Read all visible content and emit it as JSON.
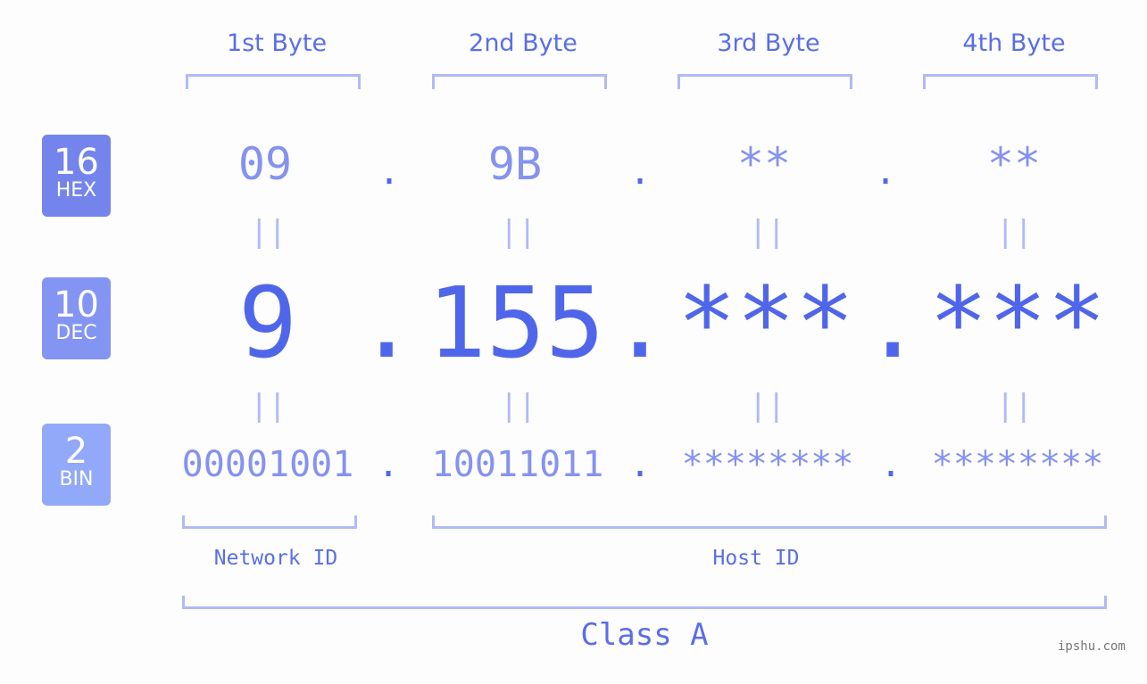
{
  "bytes": [
    {
      "label": "1st Byte",
      "hex": "09",
      "dec": "9",
      "bin": "00001001"
    },
    {
      "label": "2nd Byte",
      "hex": "9B",
      "dec": "155",
      "bin": "10011011"
    },
    {
      "label": "3rd Byte",
      "hex": "**",
      "dec": "***",
      "bin": "********"
    },
    {
      "label": "4th Byte",
      "hex": "**",
      "dec": "***",
      "bin": "********"
    }
  ],
  "separator": ".",
  "equals": "||",
  "bases": [
    {
      "num": "16",
      "name": "HEX",
      "color": "#7484ec"
    },
    {
      "num": "10",
      "name": "DEC",
      "color": "#8494f2"
    },
    {
      "num": "2",
      "name": "BIN",
      "color": "#92a8f8"
    }
  ],
  "segments": {
    "network": "Network ID",
    "host": "Host ID"
  },
  "class_label": "Class A",
  "watermark": "ipshu.com"
}
